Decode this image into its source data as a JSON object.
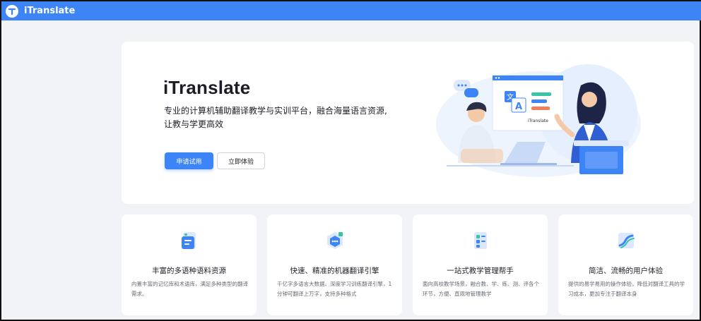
{
  "app": {
    "brand": "iTranslate"
  },
  "hero": {
    "title": "iTranslate",
    "desc_line1": "专业的计算机辅助翻译教学与实训平台，融合海量语言资源,",
    "desc_line2": "让教与学更高效",
    "primary_button": "申请试用",
    "secondary_button": "立即体验",
    "illustration_label": "iTranslate"
  },
  "features": [
    {
      "icon": "document-list-icon",
      "title": "丰富的多语种语料资源",
      "desc": "内置丰富的记忆库和术语库，满足多种类型的翻译需求。"
    },
    {
      "icon": "cube-chat-icon",
      "title": "快速、精准的机器翻译引擎",
      "desc": "千亿字多语言大数据、深度学习训练翻译引擎，1分钟可翻译上万字，支持多种格式"
    },
    {
      "icon": "management-panel-icon",
      "title": "一站式教学管理帮手",
      "desc": "面向高校教学场景，融合教、学、练、测、评各个环节，方便、直观地管理教学"
    },
    {
      "icon": "trend-chart-icon",
      "title": "简洁、流畅的用户体验",
      "desc": "提供的易学易用的操作体验，降低对翻译工具的学习成本，更加专注于翻译本身"
    }
  ],
  "colors": {
    "primary": "#3d85f7",
    "background": "#f2f3f7",
    "card": "#ffffff"
  }
}
